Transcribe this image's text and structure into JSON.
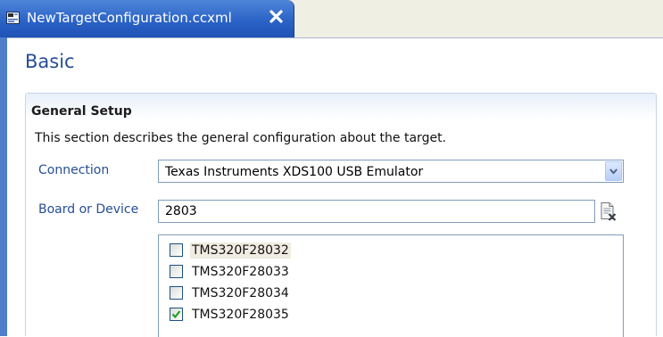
{
  "tab": {
    "title": "NewTargetConfiguration.ccxml",
    "icon": "target-config-file-icon",
    "close_icon": "close-icon"
  },
  "page": {
    "title": "Basic"
  },
  "section": {
    "title": "General Setup",
    "description": "This section describes the general configuration about the target."
  },
  "connection": {
    "label": "Connection",
    "value": "Texas Instruments XDS100 USB Emulator"
  },
  "board": {
    "label": "Board or Device",
    "value": "2803",
    "clear_icon": "clear-filter-icon"
  },
  "devices": [
    {
      "label": "TMS320F28032",
      "checked": false
    },
    {
      "label": "TMS320F28033",
      "checked": false
    },
    {
      "label": "TMS320F28034",
      "checked": false
    },
    {
      "label": "TMS320F28035",
      "checked": true
    }
  ],
  "colors": {
    "tab_active": "#2b63c7",
    "heading_blue": "#264e96",
    "section_border": "#c6d5ea",
    "checkmark": "#21a121"
  }
}
